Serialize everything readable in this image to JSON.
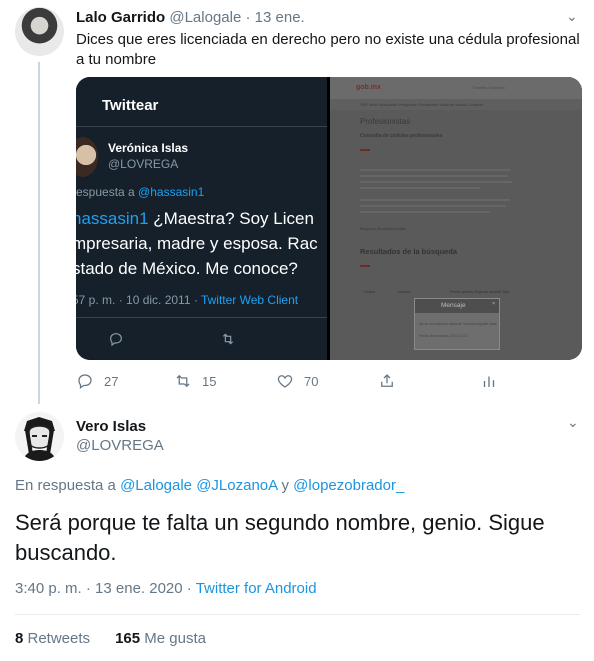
{
  "parent_tweet": {
    "author_name": "Lalo Garrido",
    "handle": "@Lalogale",
    "separator": "·",
    "date": "13 ene.",
    "text": "Dices que eres licenciada en derecho pero no existe una cédula profesional a tu nombre",
    "actions": {
      "replies": "27",
      "retweets": "15",
      "likes": "70"
    },
    "media_left": {
      "header_title": "Twittear",
      "author_name": "Verónica Islas",
      "handle": "@LOVREGA",
      "reply_prefix": "respuesta a ",
      "reply_handle": "@hassasin1",
      "body_line1_link": "hassasin1",
      "body_line1_rest": " ¿Maestra? Soy Licen",
      "body_line2": "mpresaria, madre y esposa. Rac",
      "body_line3": "stado de México. Me conoce?",
      "meta_time": "57 p. m. · 10 dic. 2011 · ",
      "meta_client": "Twitter Web Client"
    },
    "media_right": {
      "logo": "gob.mx",
      "top_links": "Trámites   Gobierno",
      "nav": "SEP        Inicio      Búsqueda      Preguntas Frecuentes      Visita de ayuda      Contacto",
      "heading": "Profesionistas",
      "subheading": "Consulta de cédulas profesionales",
      "tabs": "Búsqueda    Resultados    Detalle",
      "results_heading": "Resultados de la búsqueda",
      "col_cedula": "Cédula",
      "col_nombre": "Nombre",
      "col_apellido": "Primer apellido  Segundo apellido  Tipo",
      "modal_title": "Mensaje",
      "modal_close": "×",
      "modal_line1": "No se encontraron datos de Veronica Aguilar Islas",
      "modal_line2": "Fecha de consulta: 2019-12-01"
    }
  },
  "main_tweet": {
    "author_name": "Vero Islas",
    "handle": "@LOVREGA",
    "reply_prefix": "En respuesta a ",
    "reply_to": [
      "@Lalogale",
      "@JLozanoA",
      "y",
      "@lopezobrador_"
    ],
    "text": "Será porque te falta un segundo nombre, genio. Sigue buscando.",
    "time": "3:40 p. m. · 13 ene. 2020 · ",
    "client": "Twitter for Android",
    "retweets_count": "8",
    "retweets_label": " Retweets",
    "likes_count": "165",
    "likes_label": " Me gusta"
  },
  "icons": {
    "chevron": "chevron-down-icon",
    "reply": "reply-icon",
    "retweet": "retweet-icon",
    "like": "heart-icon",
    "share": "share-icon",
    "analytics": "analytics-icon"
  },
  "colors": {
    "link": "#1b95e0",
    "muted": "#657786",
    "dark_bg": "#15202b"
  }
}
